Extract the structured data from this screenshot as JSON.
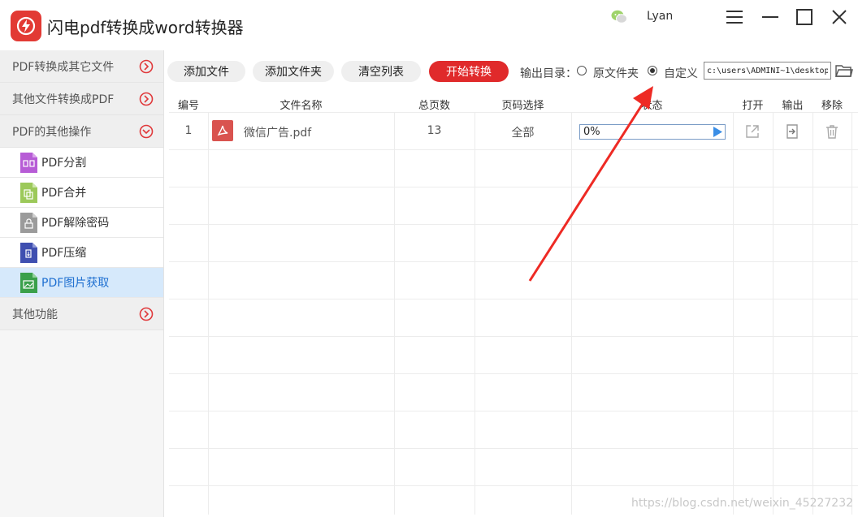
{
  "app": {
    "title": "闪电pdf转换成word转换器"
  },
  "user": {
    "name": "Lyan"
  },
  "sidebar": {
    "categories": [
      {
        "label": "PDF转换成其它文件"
      },
      {
        "label": "其他文件转换成PDF"
      },
      {
        "label": "PDF的其他操作"
      },
      {
        "label": "其他功能"
      }
    ],
    "sub_items": [
      {
        "label": "PDF分割",
        "icon": "pdf-split-icon",
        "color": "#b75cd6"
      },
      {
        "label": "PDF合并",
        "icon": "pdf-merge-icon",
        "color": "#9cc95a"
      },
      {
        "label": "PDF解除密码",
        "icon": "pdf-unlock-icon",
        "color": "#9b9b9b"
      },
      {
        "label": "PDF压缩",
        "icon": "pdf-compress-icon",
        "color": "#3f4fb0"
      },
      {
        "label": "PDF图片获取",
        "icon": "pdf-image-icon",
        "color": "#3aa04a"
      }
    ],
    "active_item": "PDF图片获取"
  },
  "toolbar": {
    "add_file": "添加文件",
    "add_folder": "添加文件夹",
    "clear_list": "清空列表",
    "start_convert": "开始转换",
    "output_label": "输出目录：",
    "option_original": "原文件夹",
    "option_custom": "自定义",
    "selected_option": "自定义",
    "path_value": "c:\\users\\ADMINI~1\\desktop"
  },
  "table": {
    "headers": {
      "num": "编号",
      "name": "文件名称",
      "pages": "总页数",
      "page_select": "页码选择",
      "status": "状态",
      "open": "打开",
      "output": "输出",
      "remove": "移除"
    },
    "rows": [
      {
        "num": "1",
        "name": "微信广告.pdf",
        "pages": "13",
        "page_select": "全部",
        "progress": "0%",
        "progress_value": 0
      }
    ]
  },
  "colors": {
    "accent_red": "#e02a2b",
    "active_blue": "#1e6fd0",
    "annotation_arrow": "#ee2a24"
  },
  "watermark": "https://blog.csdn.net/weixin_45227232"
}
